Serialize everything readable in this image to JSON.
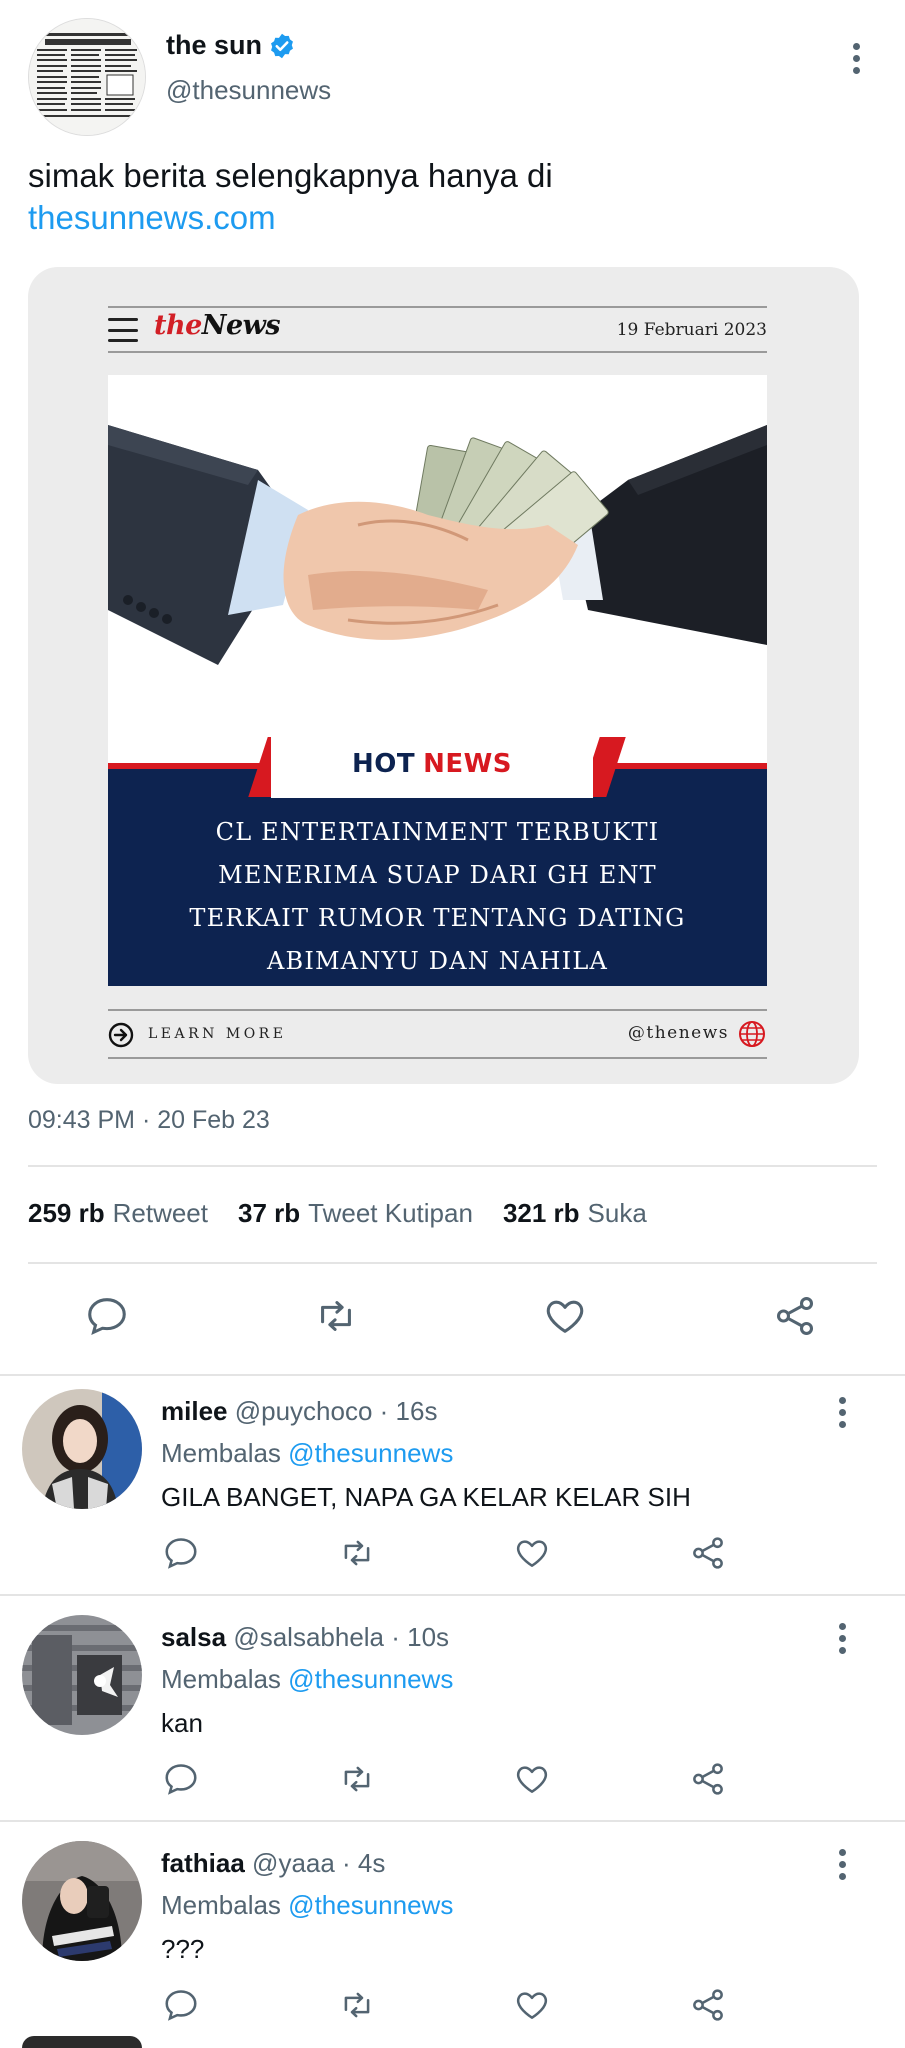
{
  "tweet": {
    "author_name": "the sun",
    "author_handle": "@thesunnews",
    "text": "simak berita selengkapnya hanya di",
    "link": "thesunnews.com",
    "timestamp": "09:43 PM · 20 Feb 23"
  },
  "card": {
    "logo_the": "the",
    "logo_news": "News",
    "date": "19 Februari 2023",
    "hot_label": "HOT",
    "news_label": "NEWS",
    "headline_lines": [
      "CL ENTERTAINMENT TERBUKTI",
      "MENERIMA SUAP DARI GH ENT",
      "TERKAIT RUMOR TENTANG DATING",
      "ABIMANYU DAN NAHILA"
    ],
    "learn_more": "LEARN MORE",
    "handle": "@thenews"
  },
  "stats": [
    {
      "count": "259 rb",
      "label": "Retweet"
    },
    {
      "count": "37 rb",
      "label": "Tweet Kutipan"
    },
    {
      "count": "321 rb",
      "label": "Suka"
    }
  ],
  "replies": [
    {
      "name": "milee",
      "meta": "@puychoco · 16s",
      "replying_prefix": "Membalas",
      "replying_to": "@thesunnews",
      "text": "GILA BANGET, NAPA GA KELAR KELAR SIH"
    },
    {
      "name": "salsa",
      "meta": "@salsabhela · 10s",
      "replying_prefix": "Membalas",
      "replying_to": "@thesunnews",
      "text": "kan"
    },
    {
      "name": "fathiaa",
      "meta": "@yaaa · 4s",
      "replying_prefix": "Membalas",
      "replying_to": "@thesunnews",
      "text": "???"
    }
  ],
  "icons": {
    "verified": "verified-badge-icon",
    "reply": "reply-icon",
    "retweet": "retweet-icon",
    "like": "heart-icon",
    "share": "share-icon",
    "more": "more-vertical-icon",
    "menu": "hamburger-icon",
    "learn_more": "arrow-circle-icon",
    "globe": "globe-icon"
  },
  "colors": {
    "link": "#1d9bf0",
    "secondary_text": "#536471",
    "card_navy": "#0d2350",
    "card_red": "#d71920"
  }
}
